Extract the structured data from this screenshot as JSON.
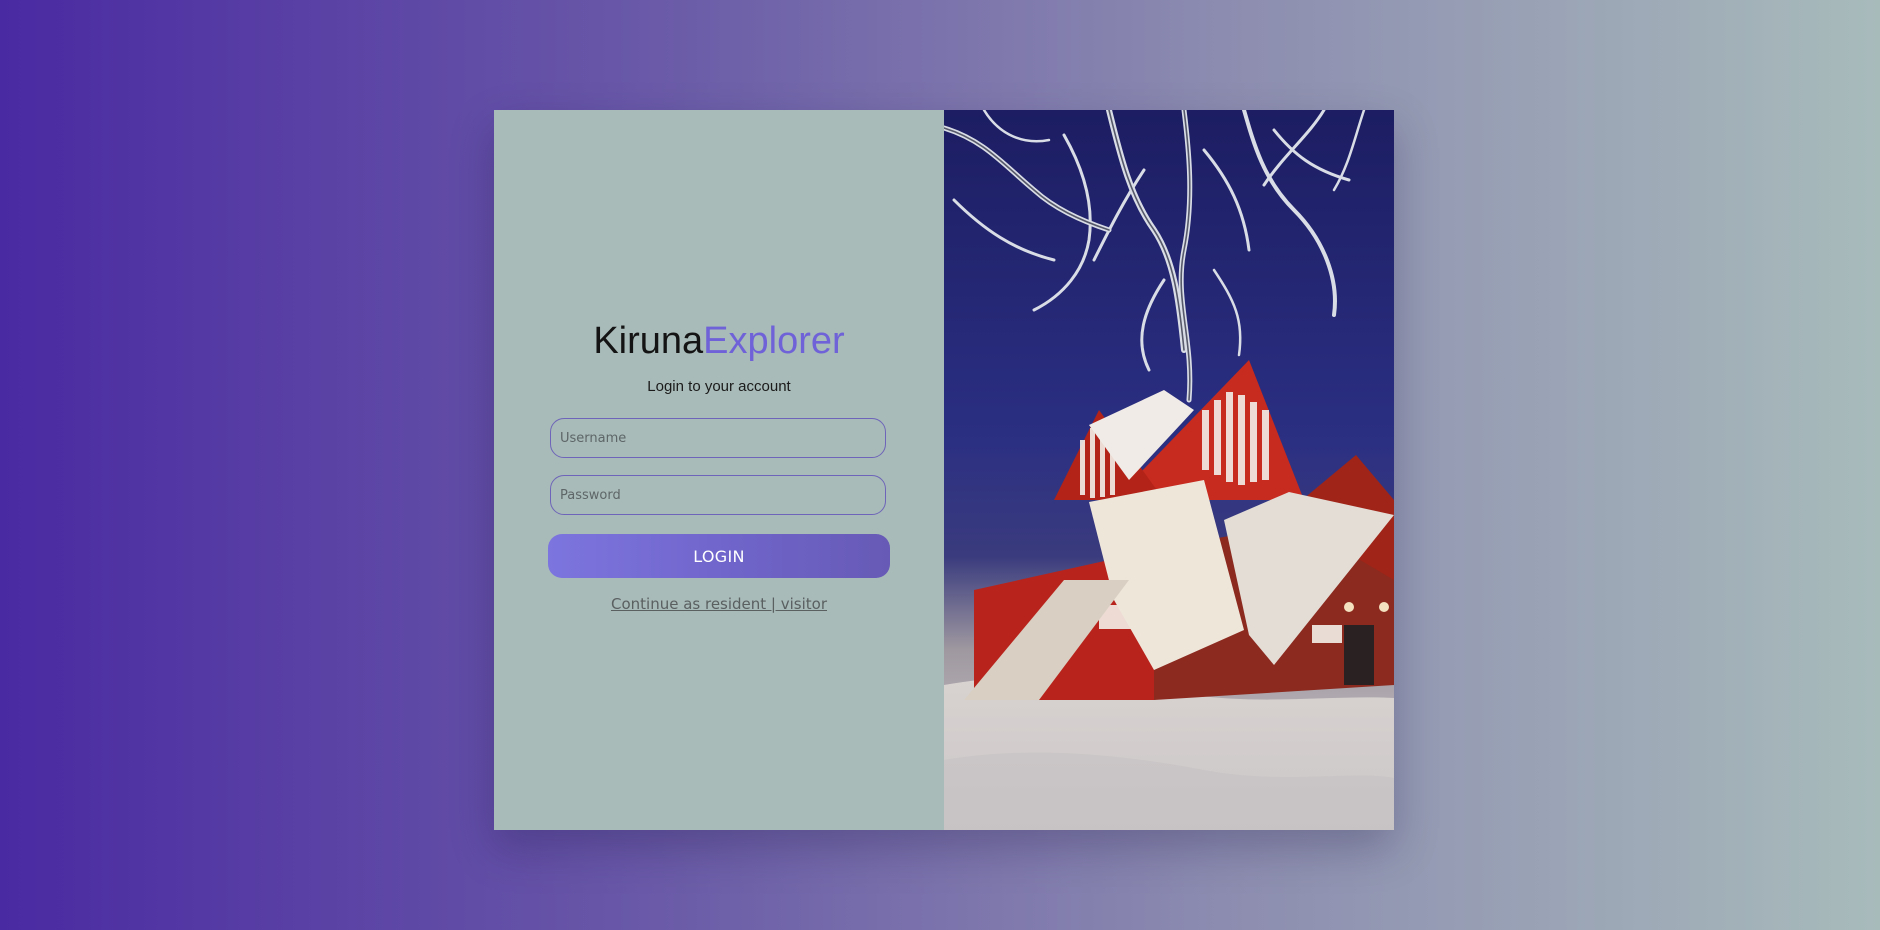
{
  "brand": {
    "part1": "Kiruna",
    "part2": "Explorer"
  },
  "login": {
    "subtitle": "Login to your account",
    "username_placeholder": "Username",
    "password_placeholder": "Password",
    "button_label": "LOGIN",
    "continue_link": "Continue as resident | visitor"
  },
  "colors": {
    "background_gradient_start": "#4a2aa2",
    "background_gradient_end": "#a8bbbb",
    "left_panel": "#a8bbb8",
    "accent": "#6f62d8"
  },
  "image": {
    "subject": "kiruna-church-winter-photo"
  }
}
